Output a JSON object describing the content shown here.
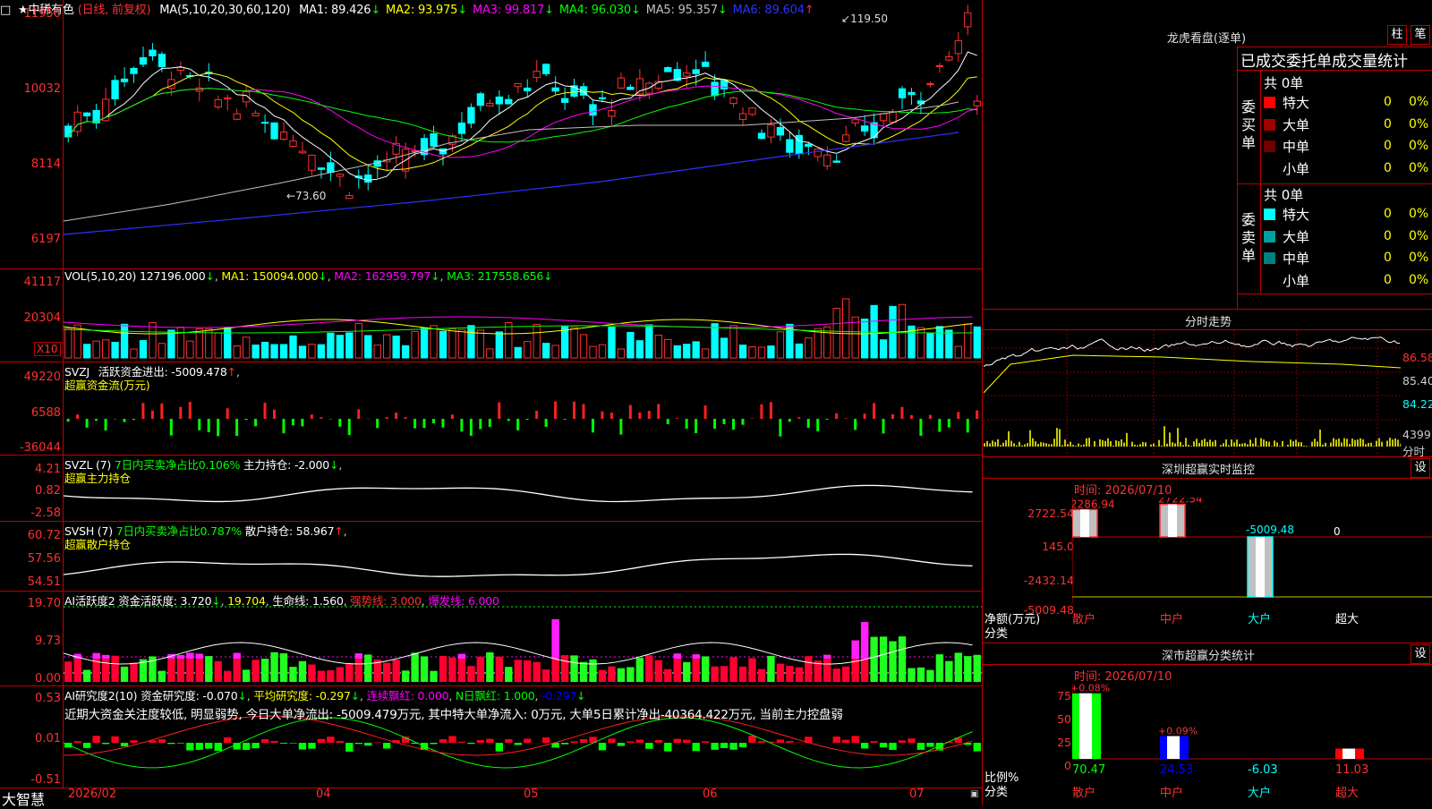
{
  "app": {
    "logo": "大智慧"
  },
  "header": {
    "star": "★",
    "stock": "中稀有色",
    "mode": "(日线, 前复权)",
    "ma_def": "MA(5,10,20,30,60,120)",
    "ma": [
      {
        "name": "MA1:",
        "val": "89.426",
        "arrow": "↓",
        "color": "#ffffff"
      },
      {
        "name": "MA2:",
        "val": "93.975",
        "arrow": "↓",
        "color": "#ffff00"
      },
      {
        "name": "MA3:",
        "val": "99.817",
        "arrow": "↓",
        "color": "#ff00ff"
      },
      {
        "name": "MA4:",
        "val": "96.030",
        "arrow": "↓",
        "color": "#00ff00"
      },
      {
        "name": "MA5:",
        "val": "95.357",
        "arrow": "↓",
        "color": "#c0c0c0"
      },
      {
        "name": "MA6:",
        "val": "89.604",
        "arrow": "↑",
        "color": "#3030ff"
      }
    ],
    "high_mark": "119.50",
    "low_mark": "73.60"
  },
  "price_axis": [
    "11950",
    "10032",
    "8114",
    "6197"
  ],
  "vol": {
    "def": "VOL(5,10,20)",
    "val": "127196.000",
    "ma1": "MA1: 150094.000",
    "ma2": "MA2: 162959.797",
    "ma3": "MA3: 217558.656",
    "axis": [
      "41117",
      "20304"
    ],
    "unit": "X10"
  },
  "svzj": {
    "def": "SVZJ",
    "label": "活跃资金进出: -5009.478",
    "arrow": "↑",
    "sub": "超赢资金流(万元)",
    "axis": [
      "49220",
      "6588",
      "-36044"
    ]
  },
  "svzl": {
    "def": "SVZL (7)",
    "pct": "7日内买卖净占比0.106%",
    "label": "主力持仓: -2.000",
    "sub": "超赢主力持仓",
    "axis": [
      "4.21",
      "0.82",
      "-2.58"
    ]
  },
  "svsh": {
    "def": "SVSH (7)",
    "pct": "7日内买卖净占比0.787%",
    "label": "散户持仓: 58.967",
    "sub": "超赢散户持仓",
    "axis": [
      "60.72",
      "57.56",
      "54.51"
    ]
  },
  "ai1": {
    "def": "AI活跃度2 资金活跃度: 3.720",
    "a2": "19.704",
    "a3": "生命线: 1.560",
    "a4": "强势线: 3.000",
    "a5": "爆发线: 6.000",
    "axis": [
      "19.70",
      "9.73",
      "0.00"
    ]
  },
  "ai2": {
    "def": "AI研究度2(10) 资金研究度: -0.070",
    "a2": "平均研究度: -0.297",
    "a3": "连续飘红: 0.000",
    "a4": "N日飘红: 1.000",
    "a5": "-0.297",
    "axis": [
      "0.53",
      "0.01",
      "-0.51"
    ],
    "comment": "近期大资金关注度较低, 明显弱势, 今日大单净流出: -5009.479万元, 其中特大单净流入: 0万元, 大单5日累计净出-40364.422万元, 当前主力控盘弱"
  },
  "dates": [
    "2026/02",
    "04",
    "05",
    "06",
    "07"
  ],
  "lhb": {
    "title": "龙虎看盘(逐单)",
    "btn1": "柱",
    "btn2": "笔",
    "header": "已成交委托单成交量统计",
    "buy": {
      "side": "委买单",
      "total": "共 0单",
      "rows": [
        {
          "n": "特大",
          "v": "0",
          "p": "0%",
          "c": "#ff0000"
        },
        {
          "n": "大单",
          "v": "0",
          "p": "0%",
          "c": "#a00000"
        },
        {
          "n": "中单",
          "v": "0",
          "p": "0%",
          "c": "#700000"
        },
        {
          "n": "小单",
          "v": "0",
          "p": "0%",
          "c": "#000000"
        }
      ]
    },
    "sell": {
      "side": "委卖单",
      "total": "共 0单",
      "rows": [
        {
          "n": "特大",
          "v": "0",
          "p": "0%",
          "c": "#00ffff"
        },
        {
          "n": "大单",
          "v": "0",
          "p": "0%",
          "c": "#00a0a0"
        },
        {
          "n": "中单",
          "v": "0",
          "p": "0%",
          "c": "#008080"
        },
        {
          "n": "小单",
          "v": "0",
          "p": "0%",
          "c": "#000000"
        }
      ]
    }
  },
  "timeshare": {
    "title": "分时走势",
    "axis": [
      "86.58",
      "85.40",
      "84.22",
      "4399",
      "分时"
    ]
  },
  "sz_monitor": {
    "title": "深圳超赢实时监控",
    "btn": "设",
    "time": "时间: 2026/07/10",
    "axis": [
      "2722.54",
      "145.0",
      "-2432.14",
      "-5009.48"
    ],
    "ylabel": "净额(万元)",
    "xlabel": "分类",
    "bars": [
      {
        "cat": "散户",
        "val": 2286.94,
        "label": "2286.94"
      },
      {
        "cat": "中户",
        "val": 2722.54,
        "label": "2722.54"
      },
      {
        "cat": "大户",
        "val": -5009.48,
        "label": "-5009.48"
      },
      {
        "cat": "超大",
        "val": 0,
        "label": "0"
      }
    ]
  },
  "sz_class": {
    "title": "深市超赢分类统计",
    "btn": "设",
    "time": "时间: 2026/07/10",
    "axis": [
      "75",
      "50",
      "25",
      "0"
    ],
    "ylabel": "比例%",
    "xlabel": "分类",
    "bars": [
      {
        "cat": "散户",
        "val": 70.47,
        "top": "+0.08%",
        "color": "#00ff00"
      },
      {
        "cat": "中户",
        "val": 24.53,
        "top": "+0.09%",
        "color": "#0000ff"
      },
      {
        "cat": "大户",
        "val": -6.03,
        "top": "",
        "color": "#00ffff"
      },
      {
        "cat": "超大",
        "val": 11.03,
        "top": "",
        "color": "#ff0000"
      }
    ]
  },
  "chart_data": {
    "type": "candlestick",
    "title": "中稀有色 日线",
    "ylim": [
      6197,
      11950
    ],
    "x_ticks": [
      "2026/02",
      "04",
      "05",
      "06",
      "07"
    ],
    "marks": {
      "high": 119.5,
      "low": 73.6
    }
  }
}
